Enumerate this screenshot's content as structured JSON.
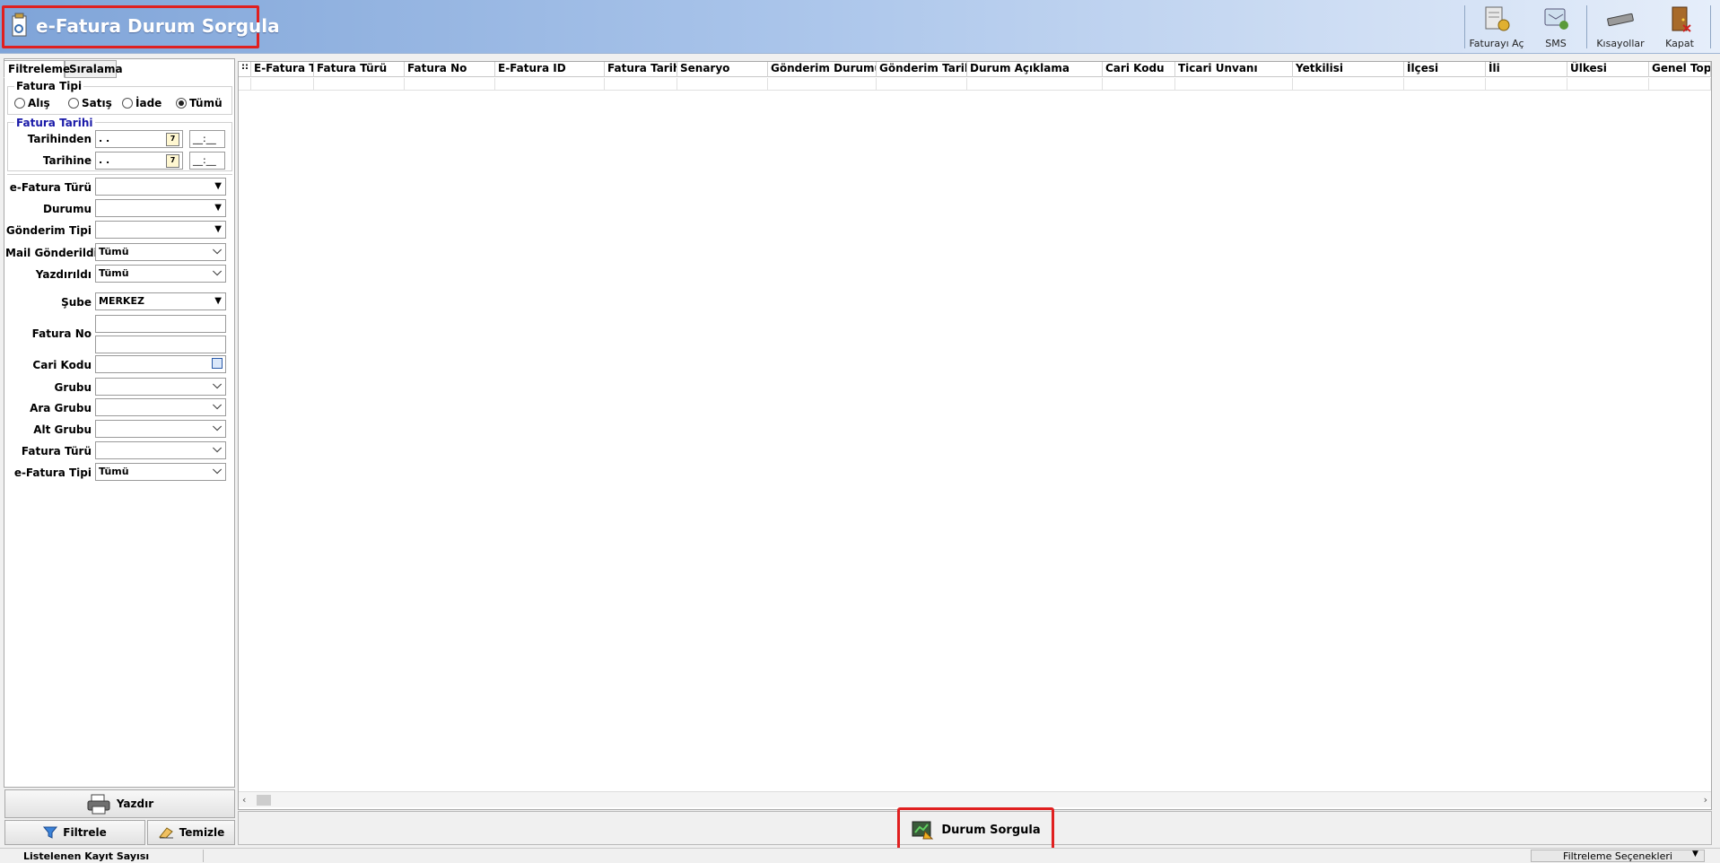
{
  "header": {
    "title": "e-Fatura Durum Sorgula",
    "toolbar": [
      {
        "label": "Faturayı Aç",
        "icon": "open-invoice-icon"
      },
      {
        "label": "SMS",
        "icon": "sms-icon"
      },
      {
        "label": "Kısayollar",
        "icon": "keyboard-icon"
      },
      {
        "label": "Kapat",
        "icon": "close-door-icon"
      }
    ]
  },
  "left_panel": {
    "tabs": [
      "Filtreleme",
      "Sıralama"
    ],
    "fatura_tipi": {
      "title": "Fatura Tipi",
      "options": [
        "Alış",
        "Satış",
        "İade",
        "Tümü"
      ],
      "selected": "Tümü"
    },
    "fatura_tarihi": {
      "title": "Fatura Tarihi",
      "from_label": "Tarihinden",
      "to_label": "Tarihine",
      "from_date": ". .",
      "to_date": ". .",
      "from_time": "__:__",
      "to_time": "__:__"
    },
    "filters": {
      "efatura_turu": {
        "label": "e-Fatura Türü",
        "value": ""
      },
      "durumu": {
        "label": "Durumu",
        "value": ""
      },
      "gonderim_tipi": {
        "label": "Gönderim Tipi",
        "value": ""
      },
      "mail_gonderildi": {
        "label": "Mail Gönderildi",
        "value": "Tümü"
      },
      "yazdirildi": {
        "label": "Yazdırıldı",
        "value": "Tümü"
      },
      "sube": {
        "label": "Şube",
        "value": "MERKEZ"
      },
      "fatura_no": {
        "label": "Fatura No",
        "value1": "",
        "value2": ""
      },
      "cari_kodu": {
        "label": "Cari Kodu",
        "value": ""
      },
      "grubu": {
        "label": "Grubu",
        "value": ""
      },
      "ara_grubu": {
        "label": "Ara Grubu",
        "value": ""
      },
      "alt_grubu": {
        "label": "Alt Grubu",
        "value": ""
      },
      "fatura_turu": {
        "label": "Fatura Türü",
        "value": ""
      },
      "efatura_tipi": {
        "label": "e-Fatura Tipi",
        "value": "Tümü"
      }
    },
    "buttons": {
      "print": "Yazdır",
      "filter": "Filtrele",
      "clear": "Temizle"
    }
  },
  "grid": {
    "columns": [
      "E-Fatura Türü",
      "Fatura Türü",
      "Fatura No",
      "E-Fatura ID",
      "Fatura Tarihi",
      "Senaryo",
      "Gönderim Durumu",
      "Gönderim Tarihi",
      "Durum Açıklama",
      "Cari Kodu",
      "Ticari Unvanı",
      "Yetkilisi",
      "İlçesi",
      "İli",
      "Ülkesi",
      "Genel Top"
    ]
  },
  "bottom": {
    "query_button": "Durum Sorgula"
  },
  "status": {
    "left": "Listelenen Kayıt Sayısı",
    "right": "Filtreleme Seçenekleri"
  }
}
